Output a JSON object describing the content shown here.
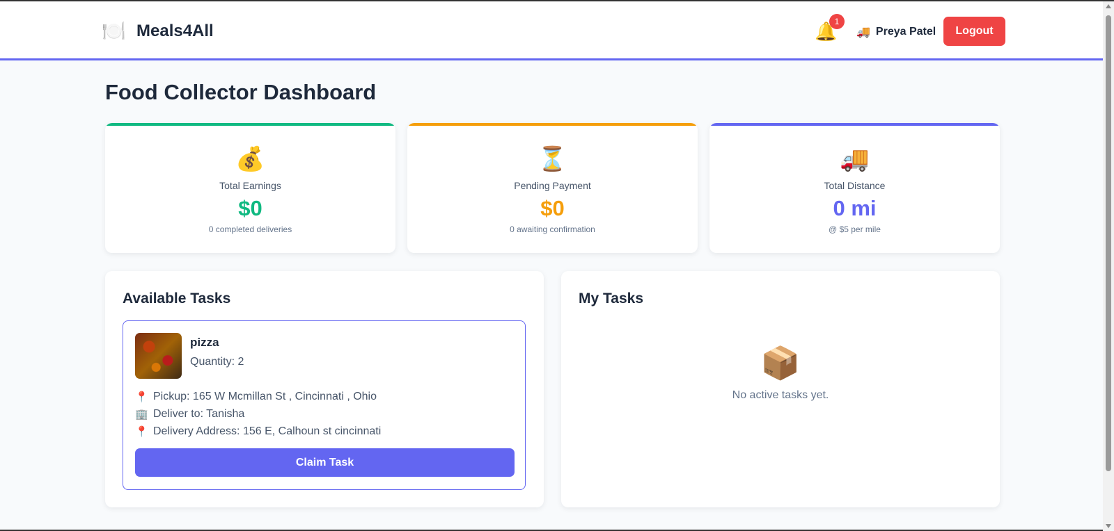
{
  "header": {
    "brand_icon": "🍽️",
    "brand_name": "Meals4All",
    "notification_icon": "🔔",
    "notification_count": "1",
    "user_icon": "🚚",
    "user_name": "Preya Patel",
    "logout_label": "Logout"
  },
  "page": {
    "title": "Food Collector Dashboard"
  },
  "stats": [
    {
      "icon": "💰",
      "label": "Total Earnings",
      "value": "$0",
      "sub": "0 completed deliveries",
      "color": "#10b981"
    },
    {
      "icon": "⏳",
      "label": "Pending Payment",
      "value": "$0",
      "sub": "0 awaiting confirmation",
      "color": "#f59e0b"
    },
    {
      "icon": "🚚",
      "label": "Total Distance",
      "value": "0 mi",
      "sub": "@ $5 per mile",
      "color": "#6366f1"
    }
  ],
  "available_tasks": {
    "title": "Available Tasks",
    "task": {
      "image": "pizza-photo",
      "name": "pizza",
      "quantity": "Quantity: 2",
      "pickup_icon": "📍",
      "pickup": "Pickup: 165 W Mcmillan St , Cincinnati , Ohio",
      "deliver_icon": "🏢",
      "deliver_to": "Deliver to: Tanisha",
      "address_icon": "📍",
      "delivery_address": "Delivery Address: 156 E, Calhoun st cincinnati",
      "claim_label": "Claim Task"
    }
  },
  "my_tasks": {
    "title": "My Tasks",
    "empty_icon": "📦",
    "empty_text": "No active tasks yet."
  }
}
